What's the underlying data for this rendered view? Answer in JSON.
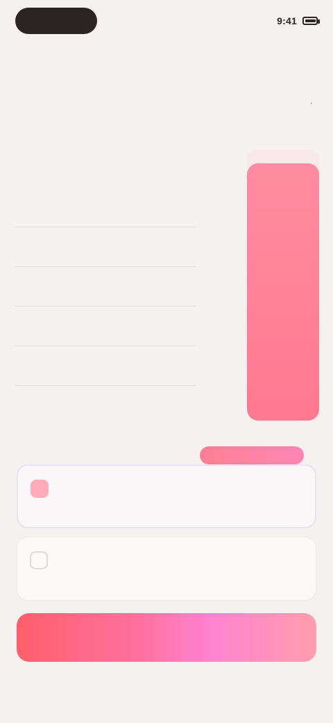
{
  "status_bar": {
    "time": "9:41",
    "battery_level": 0.85
  },
  "topbar": {
    "pill_label": ""
  },
  "hero": {
    "title_line1": "",
    "title_line2": ""
  },
  "list": {
    "items": [
      "",
      "",
      "",
      "",
      "",
      ""
    ]
  },
  "mini_labels": [
    "",
    ""
  ],
  "chart": {
    "progress_fraction": 0.95
  },
  "badge": {
    "label": ""
  },
  "cards": [
    {
      "title": "",
      "subtitle": "",
      "price": "",
      "unit": ""
    },
    {
      "title": "",
      "subtitle": "",
      "price": "",
      "unit": ""
    }
  ],
  "cta": {
    "label": ""
  },
  "footnote": ""
}
